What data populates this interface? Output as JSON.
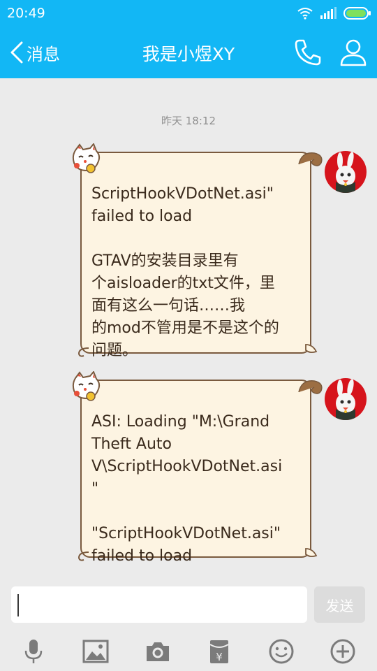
{
  "status_bar": {
    "time": "20:49"
  },
  "header": {
    "back_label": "消息",
    "title": "我是小煜XY"
  },
  "chat": {
    "timestamp": "昨天 18:12",
    "messages": [
      {
        "sender": "self",
        "text": "ScriptHookVDotNet.asi\"\nfailed to load\n\nGTAV的安装目录里有\n个aisloader的txt文件，里\n面有这么一句话……我\n的mod不管用是不是这个的\n问题。"
      },
      {
        "sender": "self",
        "text": "ASI: Loading \"M:\\Grand\nTheft Auto\nV\\ScriptHookVDotNet.asi\n\"\n\n\"ScriptHookVDotNet.asi\"\nfailed to load"
      }
    ]
  },
  "composer": {
    "input_value": "",
    "send_label": "发送"
  },
  "toolbar": {
    "items": [
      "microphone-icon",
      "image-icon",
      "camera-icon",
      "red-packet-icon",
      "emoji-icon",
      "plus-icon"
    ]
  },
  "colors": {
    "accent": "#12b7f5",
    "bubble_bg": "#fdf4e2",
    "bubble_border": "#7a5a3e",
    "avatar_red": "#d6141c",
    "icon_gray": "#7b7b7b"
  }
}
